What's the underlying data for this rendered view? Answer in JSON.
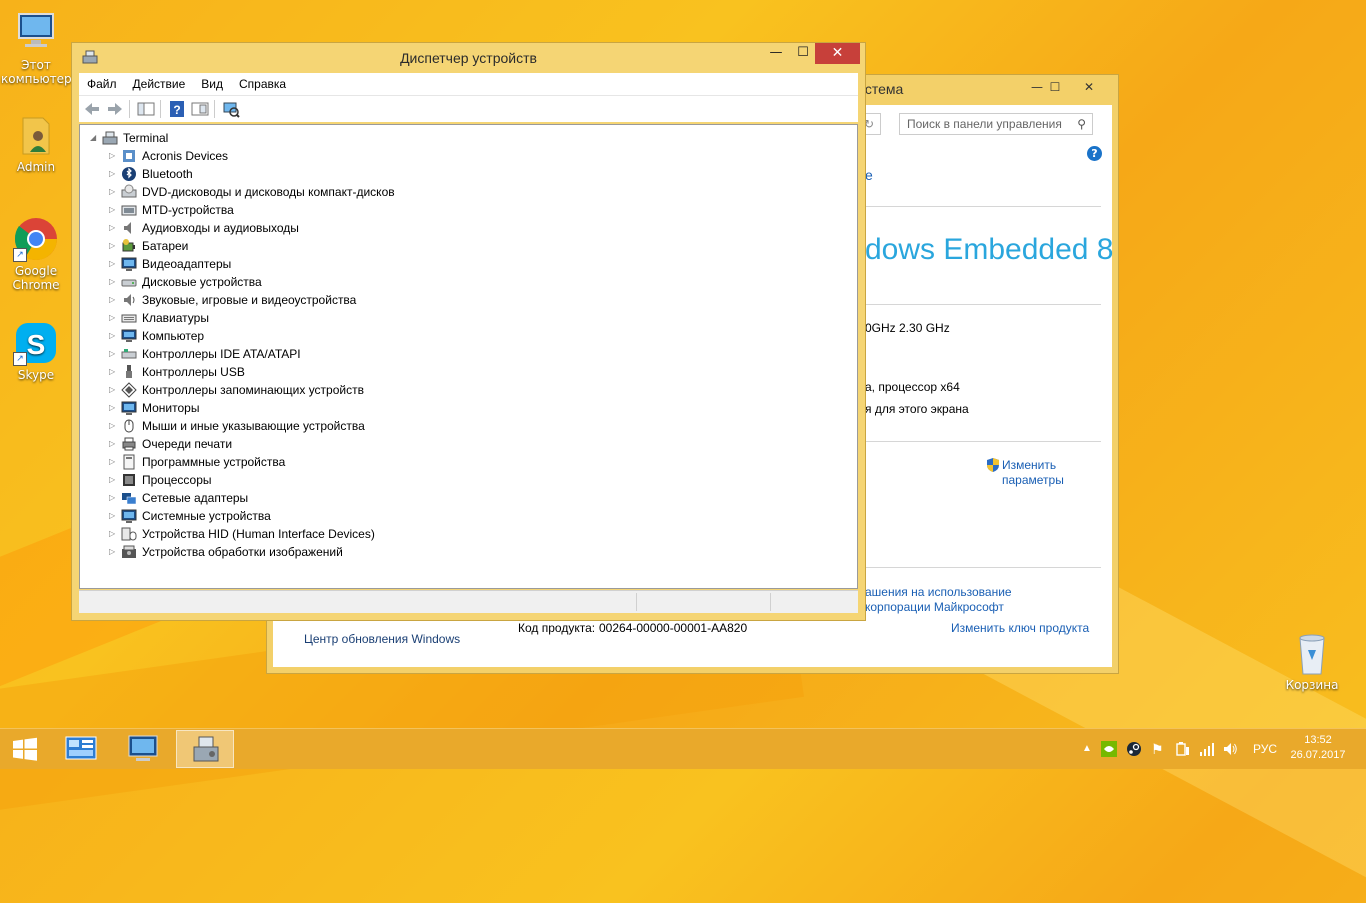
{
  "desktop": {
    "icons": [
      {
        "label": "Этот компьютер"
      },
      {
        "label": "Admin"
      },
      {
        "label": "Google Chrome"
      },
      {
        "label": "Skype"
      },
      {
        "label": "Корзина"
      }
    ]
  },
  "system_window": {
    "title": "истема",
    "search_placeholder": "Поиск в панели управления",
    "partial_top": "е",
    "os_brand": "dows Embedded 8",
    "cpu_freq": "0GHz   2.30 GHz",
    "system_type": "а, процессор x64",
    "pen_input": "я для этого экрана",
    "change_params_1": "Изменить",
    "change_params_2": "параметры",
    "license_1": "ашения на использование",
    "license_2": "корпорации Майкрософт",
    "windows_update": "Центр обновления Windows",
    "product_key_label": "Код продукта:",
    "product_key_value": "00264-00000-00001-AA820",
    "change_key": "Изменить ключ продукта"
  },
  "device_manager": {
    "title": "Диспетчер устройств",
    "menu": [
      "Файл",
      "Действие",
      "Вид",
      "Справка"
    ],
    "root": "Terminal",
    "categories": [
      {
        "label": "Acronis Devices",
        "icon": "acronis-icon"
      },
      {
        "label": "Bluetooth",
        "icon": "bluetooth-icon"
      },
      {
        "label": "DVD-дисководы и дисководы компакт-дисков",
        "icon": "dvd-drive-icon"
      },
      {
        "label": "MTD-устройства",
        "icon": "mtd-device-icon"
      },
      {
        "label": "Аудиовходы и аудиовыходы",
        "icon": "audio-io-icon"
      },
      {
        "label": "Батареи",
        "icon": "battery-icon"
      },
      {
        "label": "Видеоадаптеры",
        "icon": "display-adapter-icon"
      },
      {
        "label": "Дисковые устройства",
        "icon": "disk-drive-icon"
      },
      {
        "label": "Звуковые, игровые и видеоустройства",
        "icon": "sound-device-icon"
      },
      {
        "label": "Клавиатуры",
        "icon": "keyboard-icon"
      },
      {
        "label": "Компьютер",
        "icon": "computer-icon"
      },
      {
        "label": "Контроллеры IDE ATA/ATAPI",
        "icon": "ide-controller-icon"
      },
      {
        "label": "Контроллеры USB",
        "icon": "usb-controller-icon"
      },
      {
        "label": "Контроллеры запоминающих устройств",
        "icon": "storage-controller-icon"
      },
      {
        "label": "Мониторы",
        "icon": "monitor-icon"
      },
      {
        "label": "Мыши и иные указывающие устройства",
        "icon": "mouse-icon"
      },
      {
        "label": "Очереди печати",
        "icon": "print-queue-icon"
      },
      {
        "label": "Программные устройства",
        "icon": "software-device-icon"
      },
      {
        "label": "Процессоры",
        "icon": "processor-icon"
      },
      {
        "label": "Сетевые адаптеры",
        "icon": "network-adapter-icon"
      },
      {
        "label": "Системные устройства",
        "icon": "system-device-icon"
      },
      {
        "label": "Устройства HID (Human Interface Devices)",
        "icon": "hid-device-icon"
      },
      {
        "label": "Устройства обработки изображений",
        "icon": "imaging-device-icon"
      }
    ]
  },
  "taskbar": {
    "language": "РУС",
    "time": "13:52",
    "date": "26.07.2017"
  },
  "colors": {
    "desktop": "#f7b21a",
    "window_frame": "#f5d574",
    "close_button": "#c7403a",
    "link": "#1a5fb4",
    "brand_blue": "#2aa6dd"
  }
}
